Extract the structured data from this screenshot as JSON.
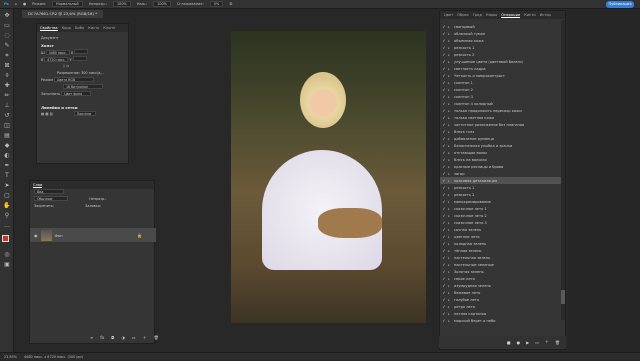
{
  "options_bar": {
    "mode_label": "Режим:",
    "mode_value": "Нормальный",
    "opacity_label": "Непрозр.:",
    "opacity_value": "100%",
    "flow_label": "Наж.:",
    "flow_value": "100%",
    "smooth_label": "Сглаживание:",
    "smooth_value": "0%",
    "share_label": "Публикация"
  },
  "document": {
    "tab_title": "DC7A7661.CR2 @ 23,6% (RGB/16) *"
  },
  "properties": {
    "tabs": [
      "Свойства",
      "Корр",
      "Библ",
      "Кисть",
      "Клонir"
    ],
    "doc_label": "Документ",
    "canvas_section": "Холст",
    "width": "4480 пикс.",
    "width_x": "X",
    "height": "6720 пикс.",
    "height_y": "Y",
    "resolution": "Разрешение: 300 пикс/д...",
    "mode_label": "Режим",
    "mode_value": "Цвета RGB",
    "bits_value": "16 бит/канал",
    "fill_label": "Заполнить",
    "fill_value": "Цвет фона",
    "rulers_section": "Линейки и сетки",
    "pixels_value": "Пиксели"
  },
  "layers": {
    "title": "Слои",
    "search_label": "Вид",
    "blend": "Обычные",
    "opacity_label": "Непрозр.:",
    "lock_label": "Закрепить:",
    "fill_label": "Заливка:",
    "layer_name": "Фон"
  },
  "history_panel": {
    "tabs": [
      "Цвет",
      "Образ",
      "Град",
      "Узоры",
      "Операции",
      "Кисти",
      "Истор"
    ],
    "active_tab": "Операции",
    "items": [
      "свинцовый",
      "облачный туман",
      "объемная кожа",
      "резкость 1",
      "резкость 2",
      "улучшение цвета (цветовой баланс)",
      "светлость кадра",
      "Четкость и микроконтраст",
      "скинтон 1",
      "скинтон 2",
      "скинтон 3",
      "скинтон 4 холодный",
      "только продолжить пересохр кожи",
      "только светлая кожа",
      "частотное разложение без плагинов",
      "блеск глаз",
      "добавление румянца",
      "Белоснежная улыбка и зрачки",
      "отстающая волос",
      "блеск на волосах",
      "красные ресницы и брови",
      "загар",
      "красивая детализация",
      "резкость 1",
      "резкость 2",
      "монохромирование",
      "сказочное лето 1",
      "сказочное лето 2",
      "сказочное лето 3",
      "сочная зелень",
      "цветное лето",
      "холодная зелень",
      "тёплая зелень",
      "пастельная зелень",
      "пастельные зеленые",
      "Золотая зелень",
      "серое лето",
      "изумрудная зелень",
      "бежевое лето",
      "голубое лето",
      "ретро лето",
      "летняя картинка",
      "морской берег и небо"
    ],
    "selected_index": 22
  },
  "status": {
    "zoom": "23,55%",
    "info": "4480 пикс. x 6720 пикс. (300 ppi)"
  },
  "colors": {
    "accent": "#3a7bd5",
    "panel": "#353535",
    "foreground_swatch": "#c43a2a",
    "background_swatch": "#ffffff"
  }
}
